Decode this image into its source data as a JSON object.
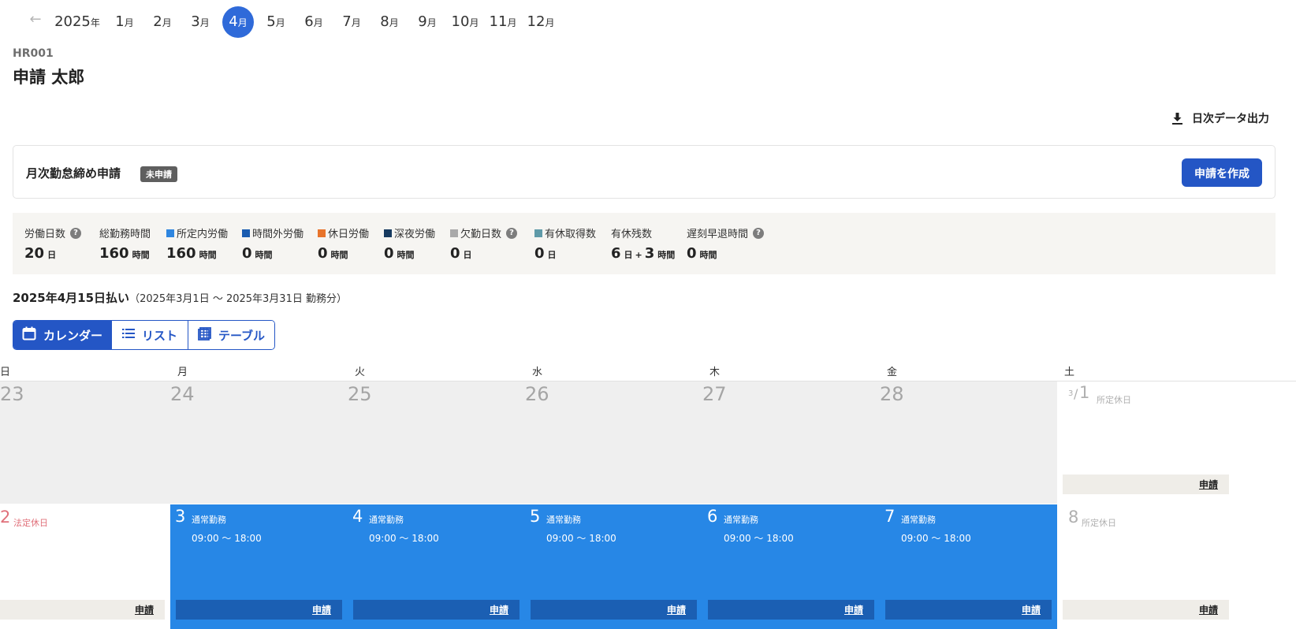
{
  "nav": {
    "back_icon": "arrow-left-icon",
    "year": {
      "num": "2025",
      "unit": "年"
    },
    "months": [
      {
        "num": "1",
        "unit": "月"
      },
      {
        "num": "2",
        "unit": "月"
      },
      {
        "num": "3",
        "unit": "月"
      },
      {
        "num": "4",
        "unit": "月",
        "active": true
      },
      {
        "num": "5",
        "unit": "月"
      },
      {
        "num": "6",
        "unit": "月"
      },
      {
        "num": "7",
        "unit": "月"
      },
      {
        "num": "8",
        "unit": "月"
      },
      {
        "num": "9",
        "unit": "月"
      },
      {
        "num": "10",
        "unit": "月"
      },
      {
        "num": "11",
        "unit": "月"
      },
      {
        "num": "12",
        "unit": "月"
      }
    ]
  },
  "employee": {
    "code": "HR001",
    "name": "申請 太郎"
  },
  "export": {
    "label": "日次データ出力",
    "icon": "download-icon"
  },
  "closing": {
    "title": "月次勤怠締め申請",
    "status": "未申請",
    "button": "申請を作成"
  },
  "stats": [
    {
      "label": "労働日数",
      "help": "?",
      "value": "20",
      "unit": "日"
    },
    {
      "label": "総勤務時間",
      "value": "160",
      "unit": "時間"
    },
    {
      "label": "所定内労働",
      "color": "#2f86e0",
      "value": "160",
      "unit": "時間"
    },
    {
      "label": "時間外労働",
      "color": "#1a5cb0",
      "value": "0",
      "unit": "時間"
    },
    {
      "label": "休日労働",
      "color": "#e8742b",
      "value": "0",
      "unit": "時間"
    },
    {
      "label": "深夜労働",
      "color": "#163a5f",
      "value": "0",
      "unit": "時間"
    },
    {
      "label": "欠勤日数",
      "color": "#a9a9a9",
      "help": "?",
      "value": "0",
      "unit": "日"
    },
    {
      "label": "有休取得数",
      "color": "#5f9aa8",
      "value": "0",
      "unit": "日"
    },
    {
      "label": "有休残数",
      "value": "6",
      "unit": "日",
      "sep": "+",
      "value2": "3",
      "unit2": "時間"
    },
    {
      "label": "遅刻早退時間",
      "help": "?",
      "value": "0",
      "unit": "時間"
    }
  ],
  "pay": {
    "date": "2025年4月15日払い",
    "period": "（2025年3月1日 ～ 2025年3月31日 勤務分）"
  },
  "views": [
    {
      "label": "カレンダー",
      "icon": "calendar-icon",
      "active": true
    },
    {
      "label": "リスト",
      "icon": "list-icon"
    },
    {
      "label": "テーブル",
      "icon": "table-icon"
    }
  ],
  "weekdays": [
    "日",
    "月",
    "火",
    "水",
    "木",
    "金",
    "土"
  ],
  "weeks": [
    [
      {
        "day": "23",
        "type": "out"
      },
      {
        "day": "24",
        "type": "out"
      },
      {
        "day": "25",
        "type": "out"
      },
      {
        "day": "26",
        "type": "out"
      },
      {
        "day": "27",
        "type": "out"
      },
      {
        "day": "28",
        "type": "out"
      },
      {
        "day": "1",
        "month_prefix": "3",
        "type": "sched-off",
        "label": "所定休日",
        "req": "申請"
      }
    ],
    [
      {
        "day": "2",
        "type": "legal-off",
        "label": "法定休日",
        "req": "申請"
      },
      {
        "day": "3",
        "type": "work",
        "label": "通常勤務",
        "time": "09:00 ～ 18:00",
        "req": "申請"
      },
      {
        "day": "4",
        "type": "work",
        "label": "通常勤務",
        "time": "09:00 ～ 18:00",
        "req": "申請"
      },
      {
        "day": "5",
        "type": "work",
        "label": "通常勤務",
        "time": "09:00 ～ 18:00",
        "req": "申請"
      },
      {
        "day": "6",
        "type": "work",
        "label": "通常勤務",
        "time": "09:00 ～ 18:00",
        "req": "申請"
      },
      {
        "day": "7",
        "type": "work",
        "label": "通常勤務",
        "time": "09:00 ～ 18:00",
        "req": "申請"
      },
      {
        "day": "8",
        "type": "sched-off",
        "label": "所定休日",
        "req": "申請"
      }
    ]
  ],
  "colors": {
    "accent": "#2456c5",
    "work_cell": "#2787e6",
    "legal_off": "#e0707a",
    "sched_off": "#b0b0b0"
  }
}
